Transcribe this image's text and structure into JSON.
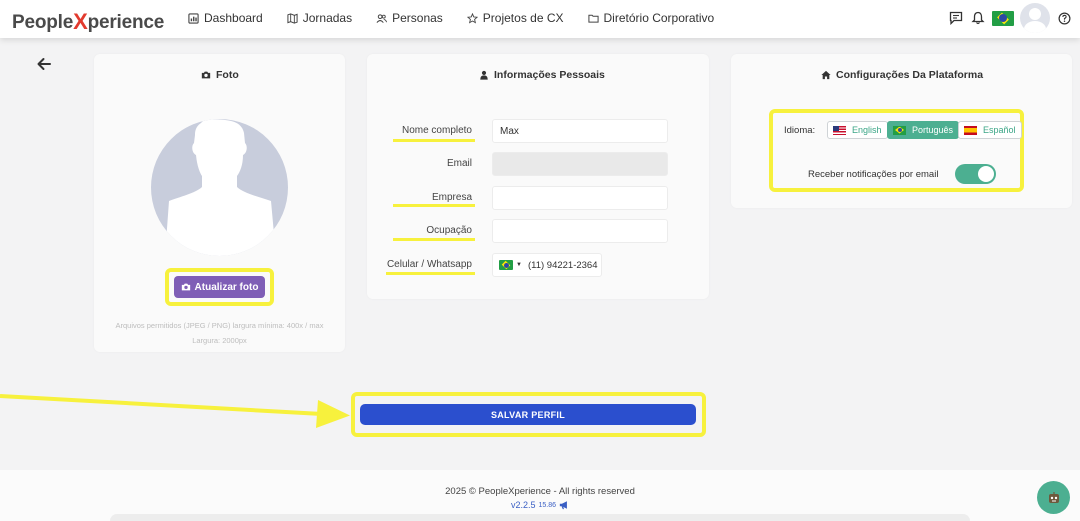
{
  "brand": {
    "name_pre": "People",
    "name_x": "X",
    "name_post": "perience"
  },
  "nav": {
    "items": [
      {
        "label": "Dashboard"
      },
      {
        "label": "Jornadas"
      },
      {
        "label": "Personas"
      },
      {
        "label": "Projetos de CX"
      },
      {
        "label": "Diretório Corporativo"
      }
    ]
  },
  "photo": {
    "title": "Foto",
    "update_label": "Atualizar foto",
    "note_line1": "Arquivos permitidos (JPEG / PNG) largura mínima: 400x / max",
    "note_line2": "Largura: 2000px"
  },
  "personal": {
    "title": "Informações Pessoais",
    "fields": {
      "name": {
        "label": "Nome completo",
        "value": "Max"
      },
      "email": {
        "label": "Email",
        "value": ""
      },
      "company": {
        "label": "Empresa",
        "value": ""
      },
      "occupation": {
        "label": "Ocupação",
        "value": ""
      },
      "phone": {
        "label": "Celular / Whatsapp",
        "value": "(11) 94221-2364"
      }
    }
  },
  "platform": {
    "title": "Configurações Da Plataforma",
    "language_label": "Idioma:",
    "languages": [
      {
        "label": "English",
        "active": false
      },
      {
        "label": "Português",
        "active": true
      },
      {
        "label": "Español",
        "active": false
      }
    ],
    "notifications_label": "Receber notificações por email",
    "notifications_on": true
  },
  "save_label": "SALVAR PERFIL",
  "footer": {
    "copyright": "2025 © PeopleXperience - All rights reserved",
    "version": "v2.2.5",
    "build": "15.86"
  },
  "colors": {
    "accent_green": "#4caf91",
    "save_blue": "#2b4fce",
    "photo_purple": "#7f5eb6",
    "highlight_yellow": "#f7f13d",
    "brand_red": "#e23a2e"
  }
}
